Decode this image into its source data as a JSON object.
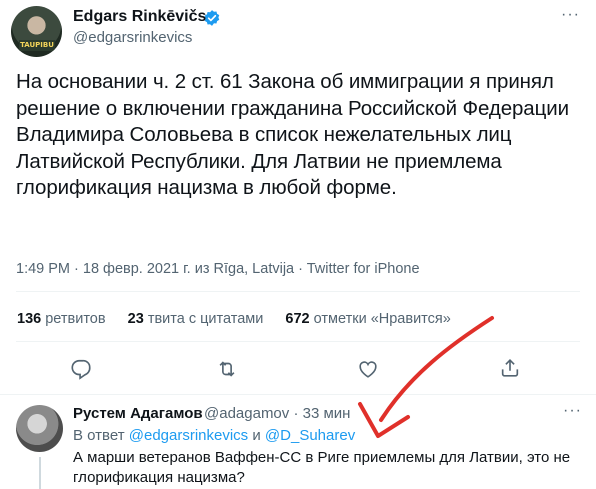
{
  "author": {
    "name": "Edgars Rinkēvičs",
    "handle": "@edgarsrinkevics",
    "avatar_tag": "TAUPIBU"
  },
  "tweet": {
    "text": "На основании ч. 2 ст. 61 Закона об иммиграции я принял решение о включении гражданина Российской Федерации Владимира Соловьева в список нежелательных лиц Латвийской Республики. Для Латвии не приемлема глорификация нацизма в любой форме.",
    "meta": "1:49 PM · 18 февр. 2021 г. из Rīga, Latvija · Twitter for iPhone"
  },
  "stats": {
    "retweets_count": "136",
    "retweets_label": "ретвитов",
    "quotes_count": "23",
    "quotes_label": "твита с цитатами",
    "likes_count": "672",
    "likes_label": "отметки «Нравится»"
  },
  "more_glyph": "···",
  "reply": {
    "name": "Рустем Адагамов",
    "handle_time": "@adagamov · 33 мин",
    "reply_prefix": "В ответ",
    "reply_to_1": "@edgarsrinkevics",
    "reply_joiner": "и",
    "reply_to_2": "@D_Suharev",
    "text": "А марши ветеранов Ваффен-СС в Риге приемлемы для Латвии, это не глорификация нацизма?"
  },
  "colors": {
    "verified": "#1d9bf0",
    "link": "#1d9bf0",
    "secondary_text": "#536471",
    "annotation_arrow": "#e0302a"
  },
  "icons": [
    "verified-badge-icon",
    "more-icon",
    "reply-icon",
    "retweet-icon",
    "like-icon",
    "share-icon",
    "annotation-arrow"
  ]
}
